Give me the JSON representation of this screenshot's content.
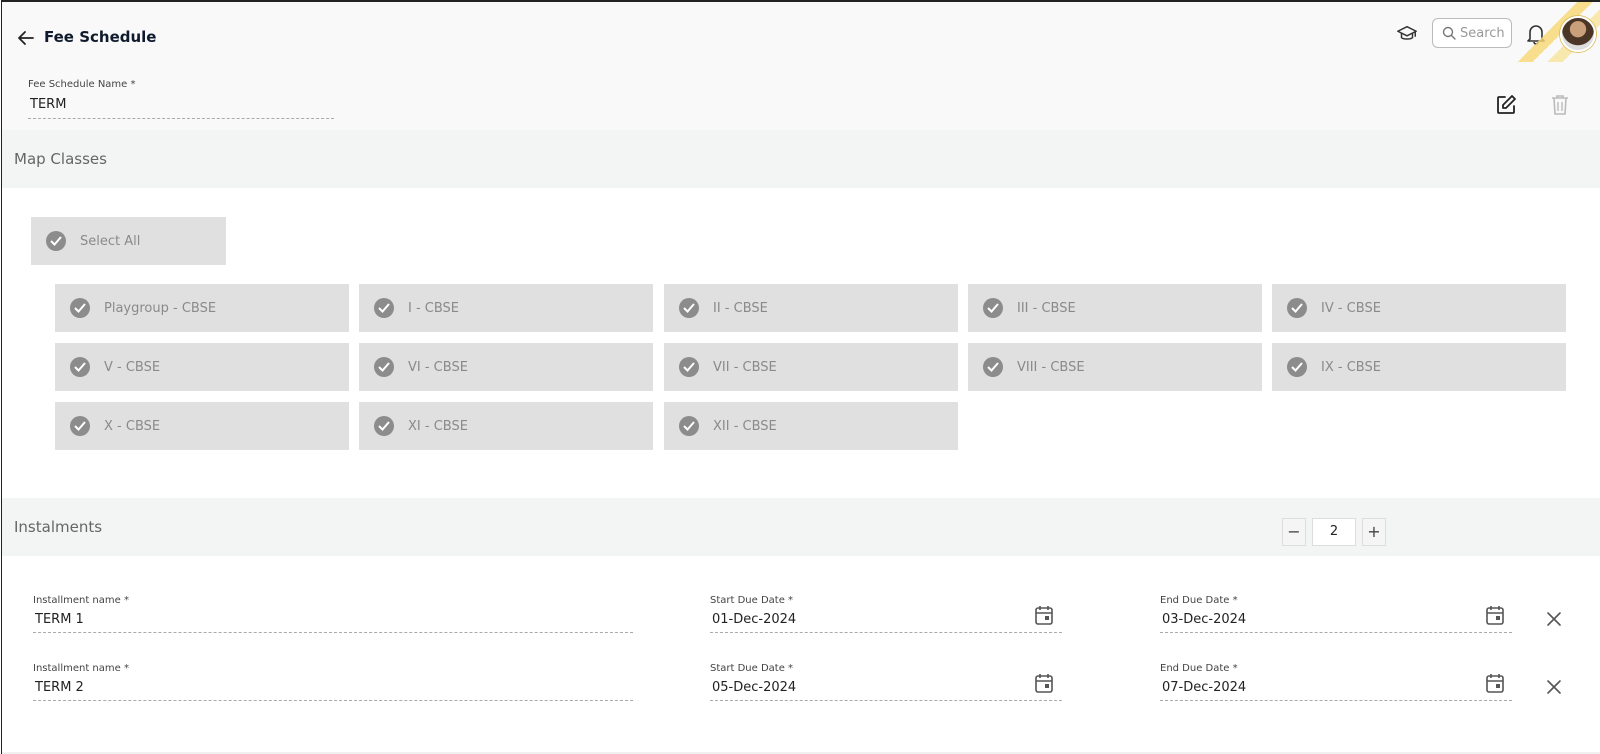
{
  "header": {
    "title": "Fee Schedule",
    "search_placeholder": "Search"
  },
  "schedule": {
    "name_label": "Fee Schedule Name *",
    "name_value": "TERM"
  },
  "map_classes": {
    "title": "Map Classes",
    "select_all_label": "Select All",
    "classes": [
      "Playgroup - CBSE",
      "I - CBSE",
      "II - CBSE",
      "III - CBSE",
      "IV - CBSE",
      "V - CBSE",
      "VI - CBSE",
      "VII - CBSE",
      "VIII - CBSE",
      "IX - CBSE",
      "X - CBSE",
      "XI - CBSE",
      "XII - CBSE"
    ]
  },
  "instalments": {
    "title": "Instalments",
    "count": "2",
    "minus": "−",
    "plus": "+",
    "rows": [
      {
        "name_label": "Installment name *",
        "name": "TERM 1",
        "start_label": "Start Due Date *",
        "start": "01-Dec-2024",
        "end_label": "End Due Date *",
        "end": "03-Dec-2024"
      },
      {
        "name_label": "Installment name *",
        "name": "TERM 2",
        "start_label": "Start Due Date *",
        "start": "05-Dec-2024",
        "end_label": "End Due Date *",
        "end": "07-Dec-2024"
      }
    ]
  },
  "colors": {
    "chip_bg": "#e0e0e0",
    "check_bg": "#8c8c8c",
    "section_bg": "#f3f4f4",
    "title": "#0f1b2d"
  }
}
